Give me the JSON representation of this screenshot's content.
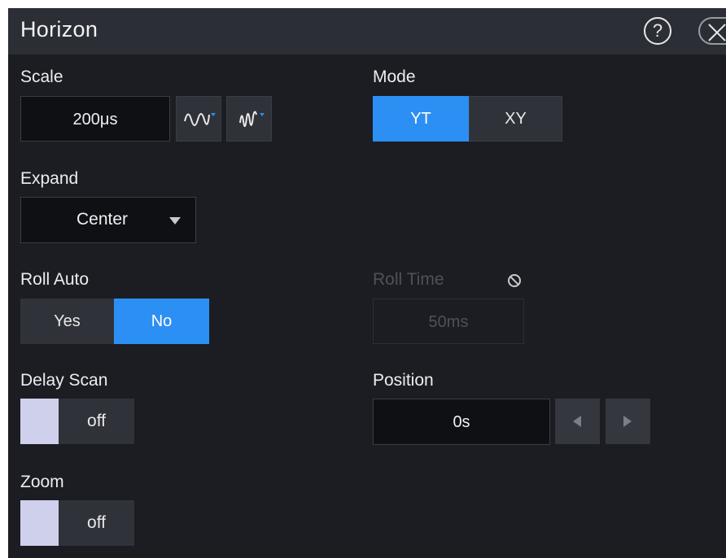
{
  "title": "Horizon",
  "scale": {
    "label": "Scale",
    "value": "200μs"
  },
  "mode": {
    "label": "Mode",
    "options": [
      "YT",
      "XY"
    ],
    "selected": "YT"
  },
  "expand": {
    "label": "Expand",
    "value": "Center"
  },
  "roll_auto": {
    "label": "Roll Auto",
    "options": [
      "Yes",
      "No"
    ],
    "selected": "No"
  },
  "roll_time": {
    "label": "Roll Time",
    "value": "50ms",
    "state_icon": "disabled-icon"
  },
  "delay_scan": {
    "label": "Delay Scan",
    "state": "off"
  },
  "position": {
    "label": "Position",
    "value": "0s"
  },
  "zoom": {
    "label": "Zoom",
    "state": "off"
  },
  "colors": {
    "accent": "#2c8ff4",
    "background": "#1b1d22",
    "titlebar": "#2b2e34",
    "toggle_knob": "#cfd0ec"
  }
}
